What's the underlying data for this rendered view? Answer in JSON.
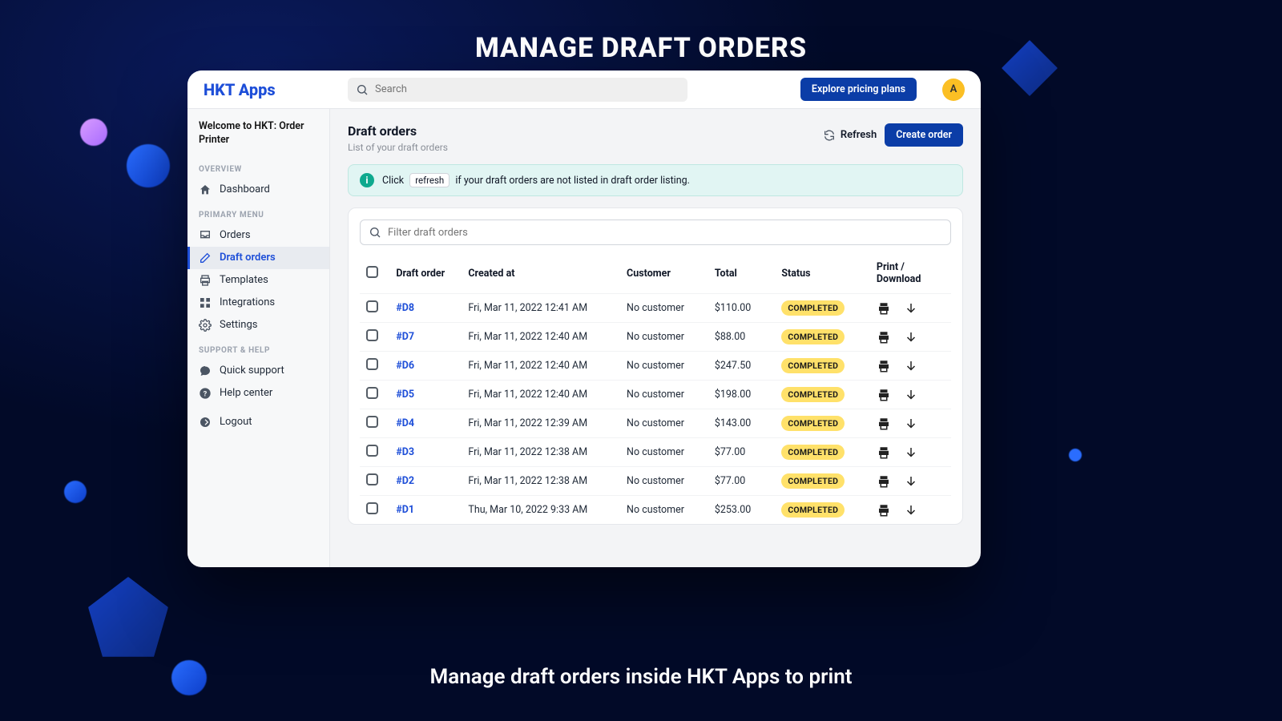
{
  "marketing": {
    "title": "MANAGE DRAFT ORDERS",
    "subtitle": "Manage draft orders inside HKT Apps to print"
  },
  "topbar": {
    "brand": "HKT Apps",
    "search_placeholder": "Search",
    "explore_label": "Explore pricing plans",
    "avatar_initial": "A"
  },
  "sidebar": {
    "welcome": "Welcome to HKT: Order Printer",
    "sections": {
      "overview": "OVERVIEW",
      "primary": "PRIMARY MENU",
      "support": "SUPPORT & HELP"
    },
    "items": {
      "dashboard": "Dashboard",
      "orders": "Orders",
      "draft_orders": "Draft orders",
      "templates": "Templates",
      "integrations": "Integrations",
      "settings": "Settings",
      "quick_support": "Quick support",
      "help_center": "Help center",
      "logout": "Logout"
    }
  },
  "page": {
    "title": "Draft orders",
    "subtitle": "List of your draft orders",
    "refresh_label": "Refresh",
    "create_label": "Create order"
  },
  "banner": {
    "text_before": "Click",
    "chip": "refresh",
    "text_after": "if your draft orders are not listed in draft order listing."
  },
  "filter": {
    "placeholder": "Filter draft orders"
  },
  "table": {
    "headers": {
      "draft_order": "Draft order",
      "created_at": "Created at",
      "customer": "Customer",
      "total": "Total",
      "status": "Status",
      "actions": "Print / Download"
    },
    "rows": [
      {
        "id": "#D8",
        "created_at": "Fri, Mar 11, 2022 12:41 AM",
        "customer": "No customer",
        "total": "$110.00",
        "status": "COMPLETED"
      },
      {
        "id": "#D7",
        "created_at": "Fri, Mar 11, 2022 12:40 AM",
        "customer": "No customer",
        "total": "$88.00",
        "status": "COMPLETED"
      },
      {
        "id": "#D6",
        "created_at": "Fri, Mar 11, 2022 12:40 AM",
        "customer": "No customer",
        "total": "$247.50",
        "status": "COMPLETED"
      },
      {
        "id": "#D5",
        "created_at": "Fri, Mar 11, 2022 12:40 AM",
        "customer": "No customer",
        "total": "$198.00",
        "status": "COMPLETED"
      },
      {
        "id": "#D4",
        "created_at": "Fri, Mar 11, 2022 12:39 AM",
        "customer": "No customer",
        "total": "$143.00",
        "status": "COMPLETED"
      },
      {
        "id": "#D3",
        "created_at": "Fri, Mar 11, 2022 12:38 AM",
        "customer": "No customer",
        "total": "$77.00",
        "status": "COMPLETED"
      },
      {
        "id": "#D2",
        "created_at": "Fri, Mar 11, 2022 12:38 AM",
        "customer": "No customer",
        "total": "$77.00",
        "status": "COMPLETED"
      },
      {
        "id": "#D1",
        "created_at": "Thu, Mar 10, 2022 9:33 AM",
        "customer": "No customer",
        "total": "$253.00",
        "status": "COMPLETED"
      }
    ]
  }
}
